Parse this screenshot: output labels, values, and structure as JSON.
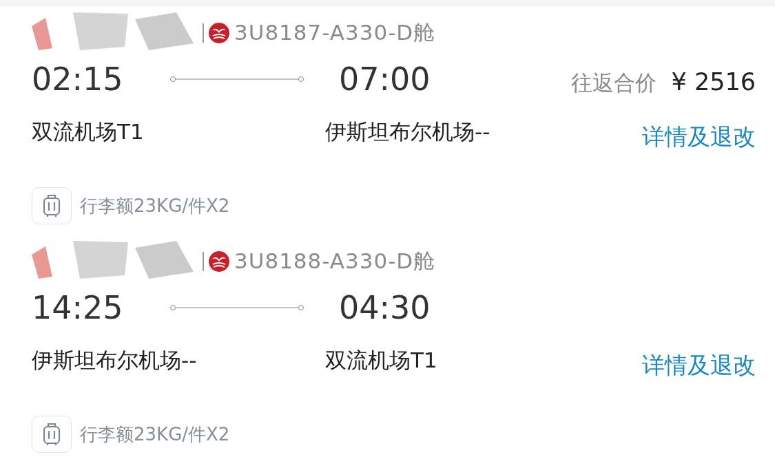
{
  "segments": [
    {
      "flight": "3U8187-A330-D舱",
      "depart_time": "02:15",
      "arrive_time": "07:00",
      "price_label": "往返合价",
      "price": "¥ 2516",
      "depart_airport": "双流机场T1",
      "arrive_airport": "伊斯坦布尔机场--",
      "link": "详情及退改",
      "baggage": "行李额23KG/件X2"
    },
    {
      "flight": "3U8188-A330-D舱",
      "depart_time": "14:25",
      "arrive_time": "04:30",
      "depart_airport": "伊斯坦布尔机场--",
      "arrive_airport": "双流机场T1",
      "link": "详情及退改",
      "baggage": "行李额23KG/件X2"
    }
  ]
}
